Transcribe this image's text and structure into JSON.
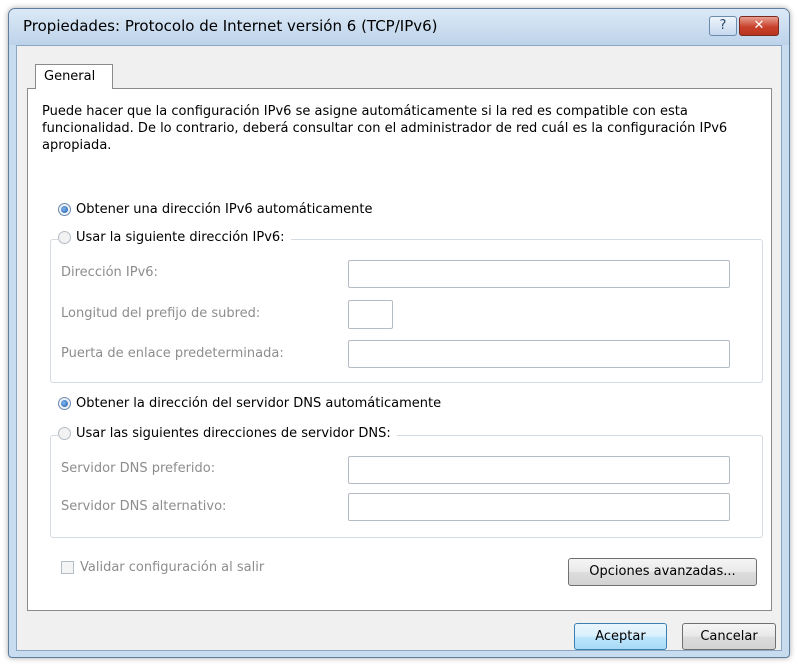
{
  "window": {
    "title": "Propiedades: Protocolo de Internet versión 6 (TCP/IPv6)",
    "help_glyph": "?",
    "close_glyph": "✕"
  },
  "tabs": [
    {
      "label": "General",
      "selected": true
    }
  ],
  "general": {
    "description": "Puede hacer que la configuración IPv6 se asigne automáticamente si la red es compatible con esta funcionalidad. De lo contrario, deberá consultar con el administrador de red cuál es la configuración IPv6 apropiada.",
    "ip_auto": {
      "label": "Obtener una dirección IPv6 automáticamente",
      "checked": true
    },
    "ip_manual": {
      "label": "Usar la siguiente dirección IPv6:",
      "checked": false,
      "enabled": false
    },
    "ip_fields": {
      "address": {
        "label": "Dirección IPv6:",
        "value": ""
      },
      "prefix": {
        "label": "Longitud del prefijo de subred:",
        "value": ""
      },
      "gateway": {
        "label": "Puerta de enlace predeterminada:",
        "value": ""
      }
    },
    "dns_auto": {
      "label": "Obtener la dirección del servidor DNS automáticamente",
      "checked": true
    },
    "dns_manual": {
      "label": "Usar las siguientes direcciones de servidor DNS:",
      "checked": false,
      "enabled": false
    },
    "dns_fields": {
      "preferred": {
        "label": "Servidor DNS preferido:",
        "value": ""
      },
      "alternate": {
        "label": "Servidor DNS alternativo:",
        "value": ""
      }
    },
    "validate": {
      "label": "Validar configuración al salir",
      "checked": false,
      "enabled": false
    },
    "advanced_label": "Opciones avanzadas..."
  },
  "footer": {
    "ok_label": "Aceptar",
    "cancel_label": "Cancelar"
  },
  "colors": {
    "frame": "#c8dcf0",
    "accent_close": "#c8412b",
    "disabled_text": "#8d8d8d"
  }
}
